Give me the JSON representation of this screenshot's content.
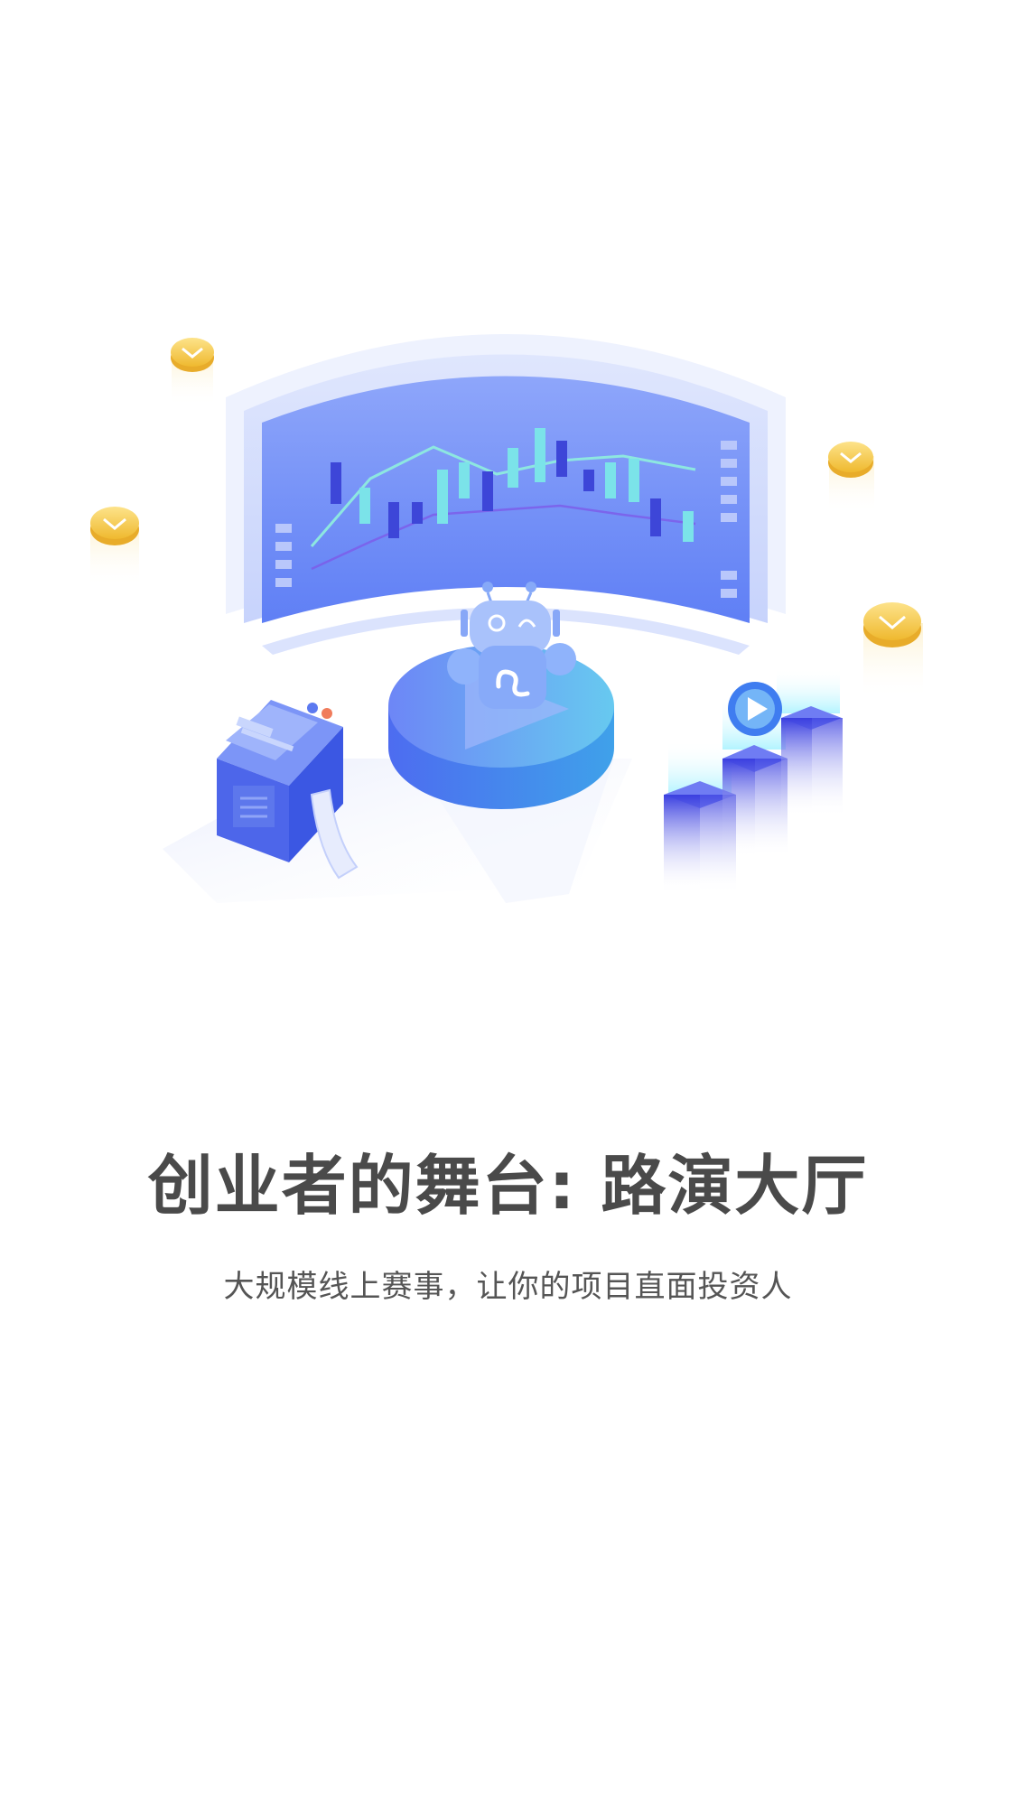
{
  "splash": {
    "title": "创业者的舞台: 路演大厅",
    "subtitle": "大规模线上赛事，让你的项目直面投资人"
  },
  "illustration": {
    "icons": [
      "coin-icon",
      "robot-icon",
      "play-icon",
      "ticket-machine-icon",
      "stock-chart-screen"
    ],
    "colors": {
      "primary_blue": "#5b7cf7",
      "light_blue": "#a9bcfb",
      "gold": "#f5c84c",
      "title_text": "#4a4a4a",
      "subtitle_text": "#555555"
    }
  }
}
